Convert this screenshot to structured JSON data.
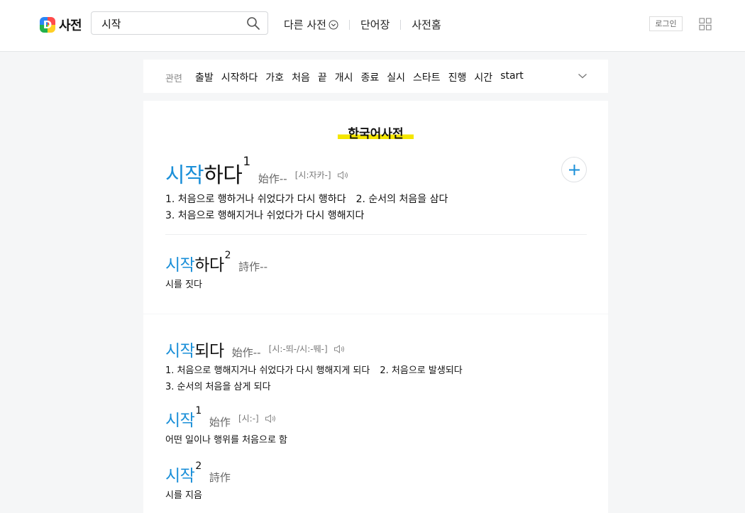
{
  "header": {
    "logo_text": "사전",
    "search_value": "시작",
    "nav": [
      "다른 사전",
      "단어장",
      "사전홈"
    ],
    "login_label": "로그인"
  },
  "related": {
    "label": "관련",
    "items": [
      "출발",
      "시작하다",
      "가호",
      "처음",
      "끝",
      "개시",
      "종료",
      "실시",
      "스타트",
      "진행",
      "시간",
      "start"
    ]
  },
  "section": {
    "title": "한국어사전"
  },
  "entries": [
    {
      "word_hl": "시작",
      "word_rest": "하다",
      "sup": "1",
      "hanja": "始作--",
      "pron": "[시:자카-]",
      "defs": [
        "1. 처음으로 행하거나 쉬었다가 다시 행하다",
        "2. 순서의 처음을 삼다",
        "3. 처음으로 행해지거나 쉬었다가 다시 행해지다"
      ]
    },
    {
      "word_hl": "시작",
      "word_rest": "하다",
      "sup": "2",
      "hanja": "詩作--",
      "defs": [
        "시를 짓다"
      ]
    },
    {
      "word_hl": "시작",
      "word_rest": "되다",
      "hanja": "始作--",
      "pron": "[시:-뙤-/시:-뛔-]",
      "defs": [
        "1.  처음으로 행해지거나 쉬었다가 다시 행해지게 되다",
        "2.  처음으로 발생되다",
        "3.  순서의 처음을 삼게 되다"
      ]
    },
    {
      "word_hl": "시작",
      "sup": "1",
      "hanja": "始作",
      "pron": "[시:-]",
      "defs": [
        "어떤 일이나 행위를 처음으로 함"
      ]
    },
    {
      "word_hl": "시작",
      "sup": "2",
      "hanja": "詩作",
      "defs": [
        "시를 지음"
      ]
    }
  ],
  "colors": {
    "accent": "#1a8fd8",
    "highlight": "#f4e600"
  },
  "icons": [
    "search-icon",
    "chevron-circle-icon",
    "apps-grid-icon",
    "chevron-down-icon",
    "plus-icon",
    "speaker-icon"
  ]
}
